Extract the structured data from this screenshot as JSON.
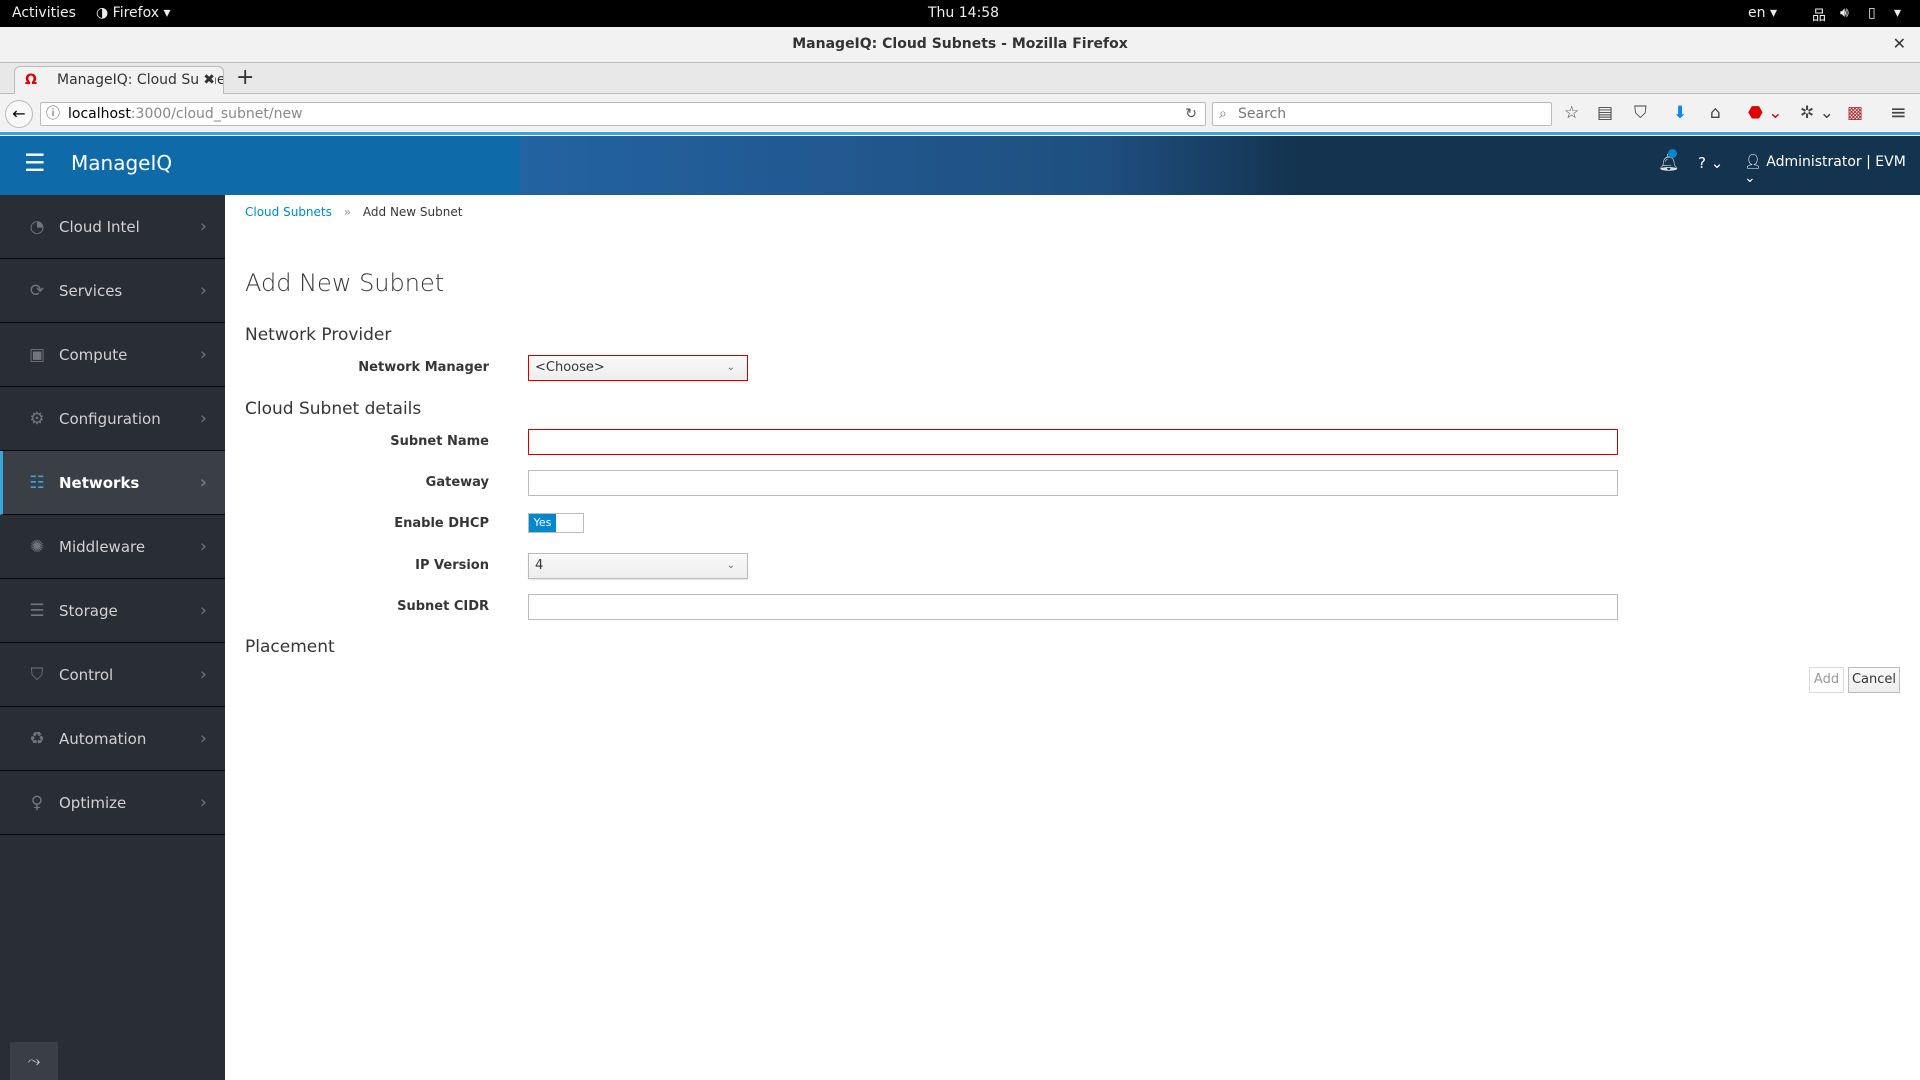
{
  "system_bar": {
    "activities": "Activities",
    "app": "Firefox",
    "clock": "Thu 14:58",
    "lang": "en"
  },
  "window": {
    "title": "ManageIQ: Cloud Subnets - Mozilla Firefox"
  },
  "browser": {
    "tab_title": "ManageIQ: Cloud Subnets",
    "url_host": "localhost",
    "url_path": ":3000/cloud_subnet/new",
    "search_placeholder": "Search"
  },
  "header": {
    "brand": "ManageIQ",
    "user": "Administrator | EVM"
  },
  "sidebar": {
    "items": [
      {
        "label": "Cloud Intel",
        "icon": "dashboard-icon",
        "glyph": "◔"
      },
      {
        "label": "Services",
        "icon": "services-icon",
        "glyph": "⟳"
      },
      {
        "label": "Compute",
        "icon": "cpu-icon",
        "glyph": "▣"
      },
      {
        "label": "Configuration",
        "icon": "gear-icon",
        "glyph": "⚙"
      },
      {
        "label": "Networks",
        "icon": "network-icon",
        "glyph": "☷",
        "active": true
      },
      {
        "label": "Middleware",
        "icon": "middleware-icon",
        "glyph": "✺"
      },
      {
        "label": "Storage",
        "icon": "database-icon",
        "glyph": "☰"
      },
      {
        "label": "Control",
        "icon": "shield-icon",
        "glyph": "⛉"
      },
      {
        "label": "Automation",
        "icon": "recycle-icon",
        "glyph": "♻"
      },
      {
        "label": "Optimize",
        "icon": "lightbulb-icon",
        "glyph": "♀"
      }
    ]
  },
  "breadcrumb": {
    "parent": "Cloud Subnets",
    "separator": "»",
    "current": "Add New Subnet"
  },
  "page": {
    "title": "Add New Subnet"
  },
  "form": {
    "section_provider": "Network Provider",
    "network_manager_label": "Network Manager",
    "network_manager_value": "<Choose>",
    "section_details": "Cloud Subnet details",
    "subnet_name_label": "Subnet Name",
    "subnet_name_value": "",
    "gateway_label": "Gateway",
    "gateway_value": "",
    "dhcp_label": "Enable DHCP",
    "dhcp_value": "Yes",
    "ip_version_label": "IP Version",
    "ip_version_value": "4",
    "cidr_label": "Subnet CIDR",
    "cidr_value": "",
    "section_placement": "Placement"
  },
  "actions": {
    "add": "Add",
    "cancel": "Cancel"
  },
  "colors": {
    "accent": "#39a5dc",
    "error": "#cc0000",
    "header": "#0e6aa8",
    "sidebar": "#292e34"
  }
}
